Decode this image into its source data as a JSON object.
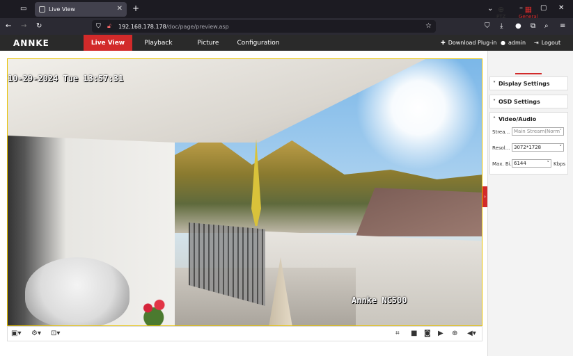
{
  "browser": {
    "tab_title": "Live View",
    "url_host": "192.168.178.178",
    "url_path": "/doc/page/preview.asp"
  },
  "app": {
    "logo": "ANNKE",
    "nav": [
      {
        "label": "Live View",
        "active": true
      },
      {
        "label": "Playback"
      },
      {
        "label": "Picture"
      },
      {
        "label": "Configuration"
      }
    ],
    "download_plugin": "Download Plug-in",
    "user": "admin",
    "logout": "Logout",
    "accent_color": "#d22a2a"
  },
  "video": {
    "osd_datetime": "10-29-2024 Tue 13:57:31",
    "osd_camera_name": "Annke NC500"
  },
  "panel": {
    "tabs": [
      {
        "label": "PTZ"
      },
      {
        "label": "General",
        "active": true
      }
    ],
    "display_settings": "Display Settings",
    "osd_settings": "OSD Settings",
    "video_audio": "Video/Audio",
    "stream_label": "Strea...",
    "stream_value": "Main Stream(Norm",
    "resolution_label": "Resol...",
    "resolution_value": "3072*1728",
    "bitrate_label": "Max. Bi...",
    "bitrate_value": "6144",
    "bitrate_unit": "Kbps"
  }
}
